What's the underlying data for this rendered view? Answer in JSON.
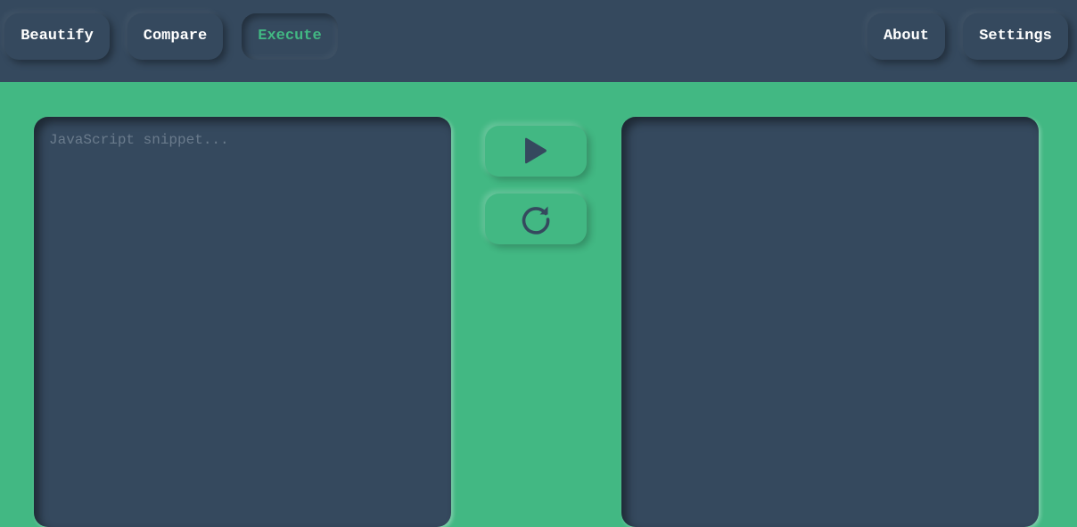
{
  "nav": {
    "beautify": "Beautify",
    "compare": "Compare",
    "execute": "Execute",
    "about": "About",
    "settings": "Settings",
    "active": "Execute"
  },
  "editor": {
    "input_value": "",
    "input_placeholder": "JavaScript snippet...",
    "output_value": ""
  },
  "actions": {
    "run_icon": "play-icon",
    "reset_icon": "refresh-icon"
  },
  "colors": {
    "accent": "#42b883",
    "dark": "#35495e",
    "text": "#ffffff",
    "placeholder": "#6a7b8c"
  }
}
